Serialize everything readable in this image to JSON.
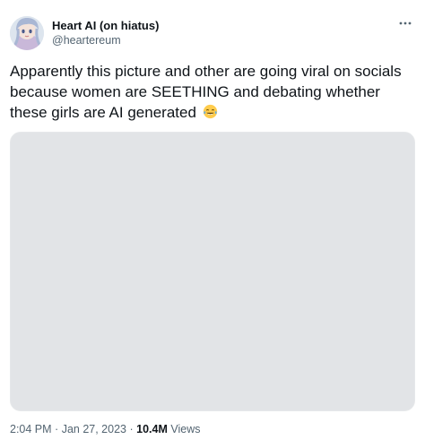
{
  "author": {
    "display_name": "Heart AI (on hiatus)",
    "handle": "@heartereum",
    "avatar_icon": "anime-avatar-icon"
  },
  "more_icon": "more-options-icon",
  "tweet": {
    "text": "Apparently this picture and other are going viral on socials because women are SEETHING and debating whether these girls are AI generated",
    "emoji_icon": "tears-of-joy-emoji-icon"
  },
  "meta": {
    "time": "2:04 PM",
    "separator": "·",
    "date": "Jan 27, 2023",
    "views_count": "10.4M",
    "views_label": "Views"
  },
  "colors": {
    "text": "#0f1419",
    "secondary": "#536471",
    "background": "#ffffff"
  }
}
